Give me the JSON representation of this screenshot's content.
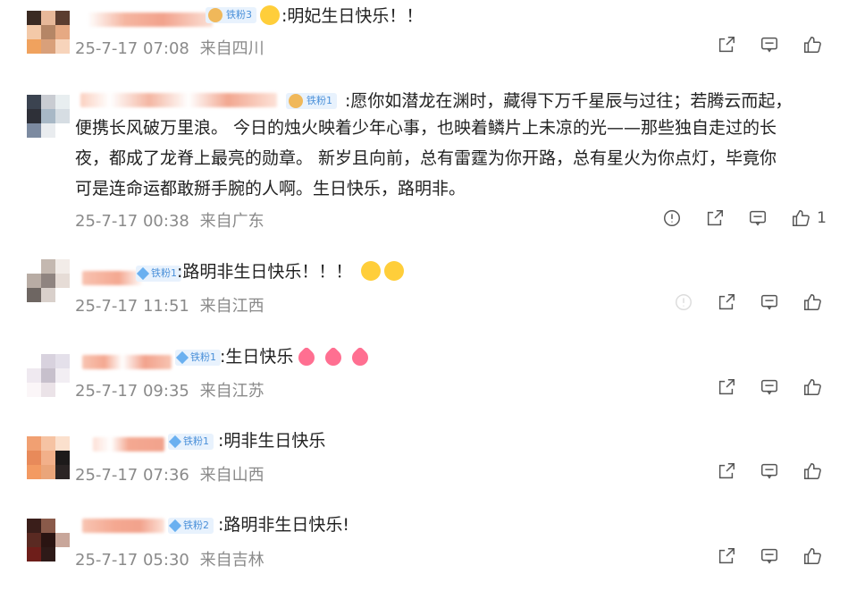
{
  "comments": [
    {
      "badge": "铁粉3",
      "text": ":明妃生日快乐！！",
      "time": "25-7-17 07:08",
      "location": "来自四川",
      "likes": ""
    },
    {
      "badge": "铁粉1",
      "text_lines": [
        ":愿你如潜龙在渊时，藏得下万千星辰与过往；若腾云而起，",
        "便携长风破万里浪。   今日的烛火映着少年心事，也映着鳞片上未凉的光——那些独自走过的长",
        "夜，都成了龙脊上最亮的勋章。   新岁且向前，总有雷霆为你开路，总有星火为你点灯，毕竟你",
        "可是连命运都敢掰手腕的人啊。生日快乐，路明非。"
      ],
      "time": "25-7-17 00:38",
      "location": "来自广东",
      "likes": "1"
    },
    {
      "badge": "铁粉1",
      "text": ":路明非生日快乐！！！",
      "time": "25-7-17 11:51",
      "location": "来自江西",
      "likes": ""
    },
    {
      "badge": "铁粉1",
      "text": ":生日快乐",
      "time": "25-7-17 09:35",
      "location": "来自江苏",
      "likes": ""
    },
    {
      "badge": "铁粉1",
      "text": ":明非生日快乐",
      "time": "25-7-17 07:36",
      "location": "来自山西",
      "likes": ""
    },
    {
      "badge": "铁粉2",
      "text": ":路明非生日快乐!",
      "time": "25-7-17 05:30",
      "location": "来自吉林",
      "likes": ""
    }
  ],
  "icons": {
    "share": "share-icon",
    "reply": "comment-icon",
    "like": "thumbs-up-icon",
    "report": "report-icon"
  },
  "colors": {
    "badge_bg": "#e8f2fd",
    "badge_text": "#4a90d9",
    "meta_text": "#8a8a8a"
  }
}
